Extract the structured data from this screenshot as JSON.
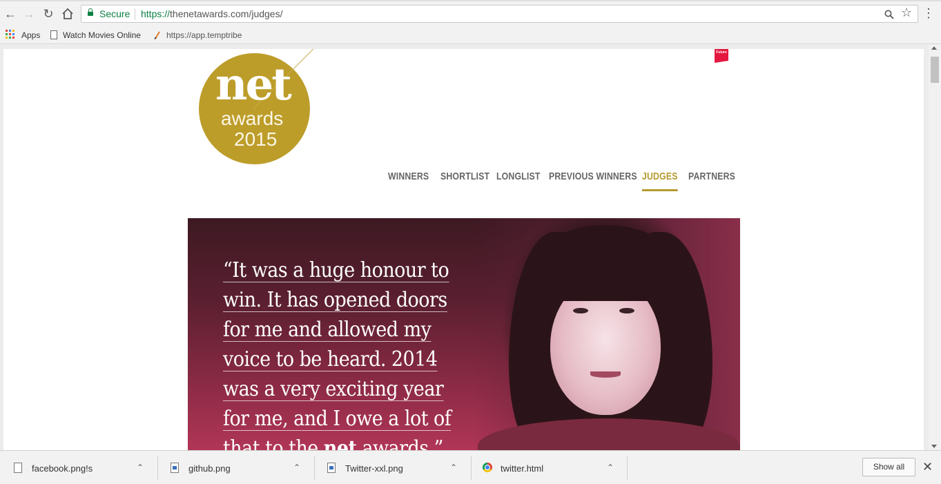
{
  "browser": {
    "secure_label": "Secure",
    "url_scheme": "https://",
    "url_host": "thenetawards.com",
    "url_path": "/judges/",
    "bookmarks": [
      {
        "label": "Apps",
        "icon": "apps-icon"
      },
      {
        "label": "Watch Movies Online",
        "icon": "page-icon"
      },
      {
        "label": "https://app.temptribe",
        "icon": "favicon-pen-icon"
      }
    ],
    "colors": {
      "secure": "#0b8043"
    }
  },
  "site": {
    "logo": {
      "word": "net",
      "sub": "awards",
      "year": "2015"
    },
    "badge": "Future",
    "nav": [
      {
        "label": "WINNERS",
        "active": false
      },
      {
        "label": "SHORTLIST",
        "active": false
      },
      {
        "label": "LONGLIST",
        "active": false
      },
      {
        "label": "PREVIOUS WINNERS",
        "active": false
      },
      {
        "label": "JUDGES",
        "active": true
      },
      {
        "label": "PARTNERS",
        "active": false
      }
    ],
    "hero": {
      "quote_lines": [
        "“It was a huge honour to",
        "win. It has opened doors",
        "for me and allowed my",
        "voice to be heard. 2014",
        "was a very exciting year",
        "for me, and I owe a lot of"
      ],
      "quote_last_prefix": "that to the ",
      "quote_last_bold": "net",
      "quote_last_suffix": " awards.”"
    },
    "colors": {
      "gold": "#bd9d2a",
      "nav_active": "#b49a2e",
      "nav": "#656565"
    }
  },
  "downloads": {
    "items": [
      {
        "name": "facebook.png!s",
        "icon": "file-icon"
      },
      {
        "name": "github.png",
        "icon": "image-file-icon"
      },
      {
        "name": "Twitter-xxl.png",
        "icon": "image-file-icon"
      },
      {
        "name": "twitter.html",
        "icon": "chrome-icon"
      }
    ],
    "show_all": "Show all"
  }
}
